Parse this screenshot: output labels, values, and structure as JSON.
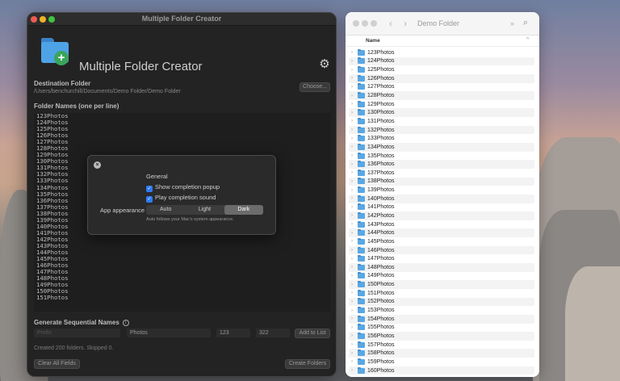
{
  "app": {
    "window_title": "Multiple Folder Creator",
    "name": "Multiple Folder Creator",
    "destination_label": "Destination Folder",
    "destination_path": "/Users/benchurchill/Documents/Demo Folder/Demo Folder",
    "choose_button": "Choose...",
    "folder_names_label": "Folder Names (one per line)",
    "folder_names": [
      "123Photos",
      "124Photos",
      "125Photos",
      "126Photos",
      "127Photos",
      "128Photos",
      "129Photos",
      "130Photos",
      "131Photos",
      "132Photos",
      "133Photos",
      "134Photos",
      "135Photos",
      "136Photos",
      "137Photos",
      "138Photos",
      "139Photos",
      "140Photos",
      "141Photos",
      "142Photos",
      "143Photos",
      "144Photos",
      "145Photos",
      "146Photos",
      "147Photos",
      "148Photos",
      "149Photos",
      "150Photos",
      "151Photos"
    ],
    "sequential_label": "Generate Sequential Names",
    "info_icon": "i",
    "prefix_placeholder": "Prefix",
    "base_name_value": "Photos",
    "start_value": "123",
    "end_value": "322",
    "add_to_list_button": "Add to List",
    "status_text": "Created 200 folders. Skipped 0.",
    "clear_button": "Clear All Fields",
    "create_button": "Create Folders"
  },
  "settings_popup": {
    "close_icon": "×",
    "section_title": "General",
    "option_popup": "Show completion popup",
    "option_sound": "Play completion sound",
    "appearance_label": "App appearance",
    "appearance_options": [
      "Auto",
      "Light",
      "Dark"
    ],
    "appearance_selected": "Dark",
    "hint": "Auto follows your Mac's system appearance."
  },
  "finder": {
    "title": "Demo Folder",
    "back_icon": "‹",
    "forward_icon": "›",
    "more_icon": "»",
    "search_icon": "⌕",
    "column_name": "Name",
    "sort_icon": "^",
    "items": [
      "123Photos",
      "124Photos",
      "125Photos",
      "126Photos",
      "127Photos",
      "128Photos",
      "129Photos",
      "130Photos",
      "131Photos",
      "132Photos",
      "133Photos",
      "134Photos",
      "135Photos",
      "136Photos",
      "137Photos",
      "138Photos",
      "139Photos",
      "140Photos",
      "141Photos",
      "142Photos",
      "143Photos",
      "144Photos",
      "145Photos",
      "146Photos",
      "147Photos",
      "148Photos",
      "149Photos",
      "150Photos",
      "151Photos",
      "152Photos",
      "153Photos",
      "154Photos",
      "155Photos",
      "156Photos",
      "157Photos",
      "158Photos",
      "159Photos",
      "160Photos"
    ]
  },
  "colors": {
    "accent_blue": "#2f7bf6",
    "folder_blue": "#5aa7e2",
    "app_background": "#232323"
  }
}
